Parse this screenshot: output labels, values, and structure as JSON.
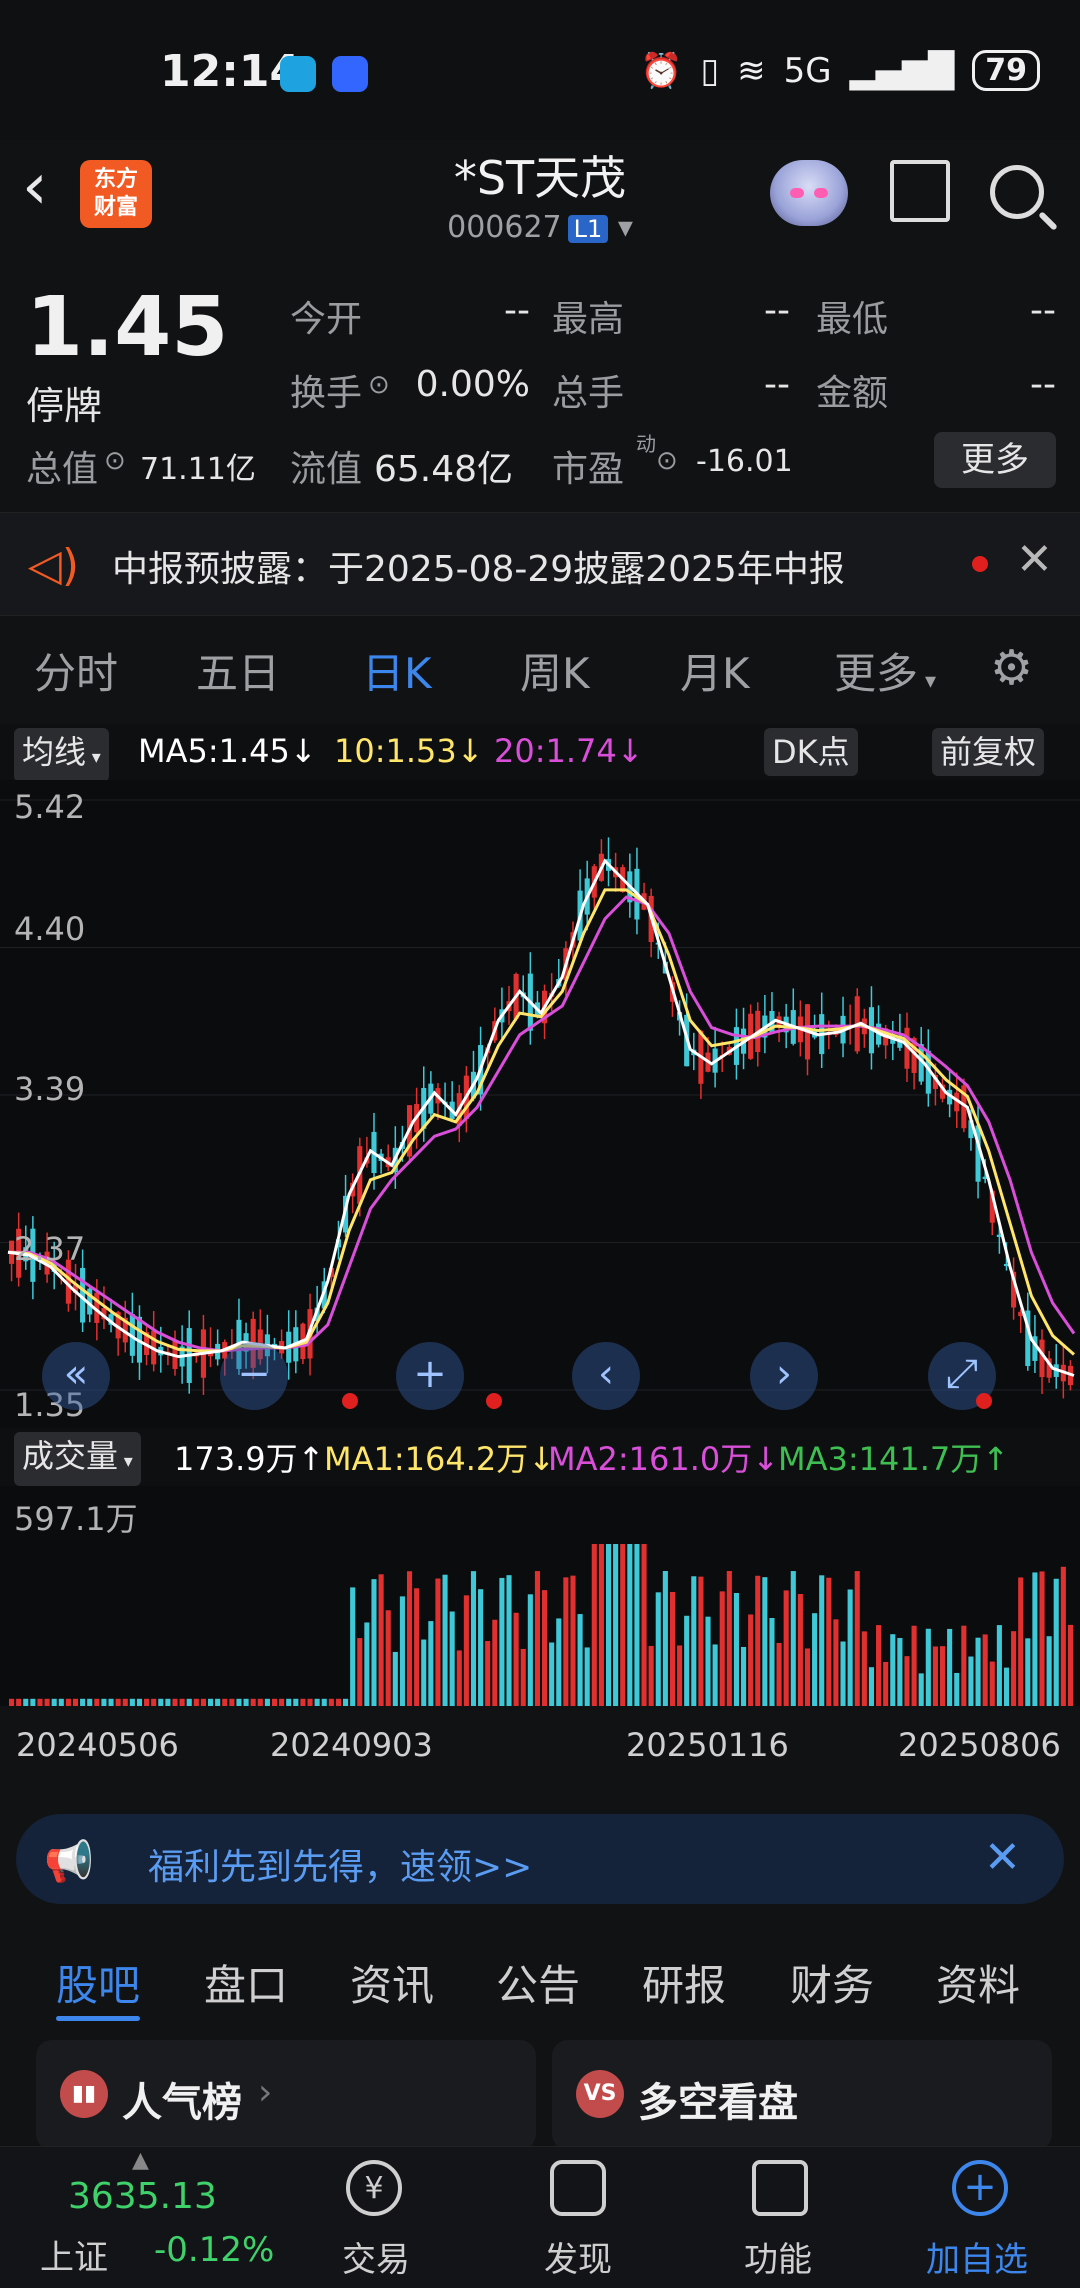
{
  "status_bar": {
    "time": "12:14",
    "battery": "79",
    "network": "5G"
  },
  "header": {
    "title": "*ST天茂",
    "code": "000627",
    "level": "L1",
    "logo_line1": "东方",
    "logo_line2": "财富"
  },
  "quote": {
    "price": "1.45",
    "price_status": "停牌",
    "rows": [
      {
        "l1": "今开",
        "v1": "--",
        "l2": "最高",
        "v2": "--",
        "l3": "最低",
        "v3": "--"
      },
      {
        "l1": "换手",
        "v1": "0.00%",
        "l2": "总手",
        "v2": "--",
        "l3": "金额",
        "v3": "--"
      }
    ],
    "total_value_label": "总值",
    "total_value": "71.11亿",
    "float_value_label": "流值",
    "float_value": "65.48亿",
    "pe_label": "市盈",
    "pe_sup": "动",
    "pe_value": "-16.01",
    "more_button": "更多"
  },
  "notice": {
    "text": "中报预披露：于2025-08-29披露2025年中报"
  },
  "period_tabs": [
    "分时",
    "五日",
    "日K",
    "周K",
    "月K",
    "更多"
  ],
  "ma_bar": {
    "label": "均线",
    "ma5": "MA5:1.45↓",
    "ma10": "10:1.53↓",
    "ma20": "20:1.74↓",
    "dk": "DK点",
    "fq": "前复权",
    "colors": {
      "ma5": "#ffffff",
      "ma10": "#ffe66b",
      "ma20": "#d94fd9"
    }
  },
  "chart_data": {
    "type": "candlestick",
    "y_ticks": [
      "5.42",
      "4.40",
      "3.39",
      "2.37",
      "1.35"
    ],
    "ylim": [
      1.35,
      5.42
    ],
    "x_ticks": [
      "20240506",
      "20240903",
      "20250116",
      "20250806"
    ],
    "ma5_path": [
      2.3,
      2.28,
      2.2,
      2.05,
      1.92,
      1.8,
      1.7,
      1.62,
      1.58,
      1.6,
      1.62,
      1.68,
      1.66,
      1.64,
      1.7,
      2.1,
      2.7,
      3.0,
      2.9,
      3.2,
      3.4,
      3.25,
      3.5,
      3.9,
      4.1,
      3.95,
      4.2,
      4.7,
      5.0,
      4.85,
      4.7,
      4.2,
      3.7,
      3.6,
      3.7,
      3.8,
      3.9,
      3.85,
      3.8,
      3.82,
      3.88,
      3.8,
      3.75,
      3.6,
      3.4,
      3.3,
      2.8,
      2.2,
      1.7,
      1.5,
      1.45
    ],
    "ma20_path": [
      2.3,
      2.3,
      2.25,
      2.15,
      2.05,
      1.95,
      1.85,
      1.75,
      1.68,
      1.64,
      1.62,
      1.63,
      1.64,
      1.64,
      1.66,
      1.8,
      2.2,
      2.6,
      2.8,
      2.95,
      3.1,
      3.15,
      3.3,
      3.55,
      3.8,
      3.9,
      4.0,
      4.3,
      4.6,
      4.75,
      4.7,
      4.5,
      4.1,
      3.85,
      3.8,
      3.78,
      3.82,
      3.85,
      3.86,
      3.86,
      3.86,
      3.84,
      3.8,
      3.7,
      3.58,
      3.45,
      3.2,
      2.8,
      2.3,
      1.95,
      1.74
    ]
  },
  "nav_buttons": [
    "«",
    "−",
    "+",
    "‹",
    "›",
    "⤢"
  ],
  "volume_bar": {
    "label": "成交量",
    "vol": "173.9万↑",
    "ma1": "MA1:164.2万↓",
    "ma2": "MA2:161.0万↓",
    "ma3": "MA3:141.7万↑",
    "y_max": "597.1万"
  },
  "promo": {
    "text": "福利先到先得，速领>>"
  },
  "info_tabs": [
    "股吧",
    "盘口",
    "资讯",
    "公告",
    "研报",
    "财务",
    "资料"
  ],
  "cards": [
    {
      "title": "人气榜",
      "icon": "chart-icon"
    },
    {
      "title": "多空看盘",
      "icon": "vs-icon"
    }
  ],
  "bottom_nav": {
    "index_value": "3635.13",
    "index_name": "上证",
    "index_change": "-0.12%",
    "items": [
      "交易",
      "发现",
      "功能",
      "加自选"
    ]
  }
}
